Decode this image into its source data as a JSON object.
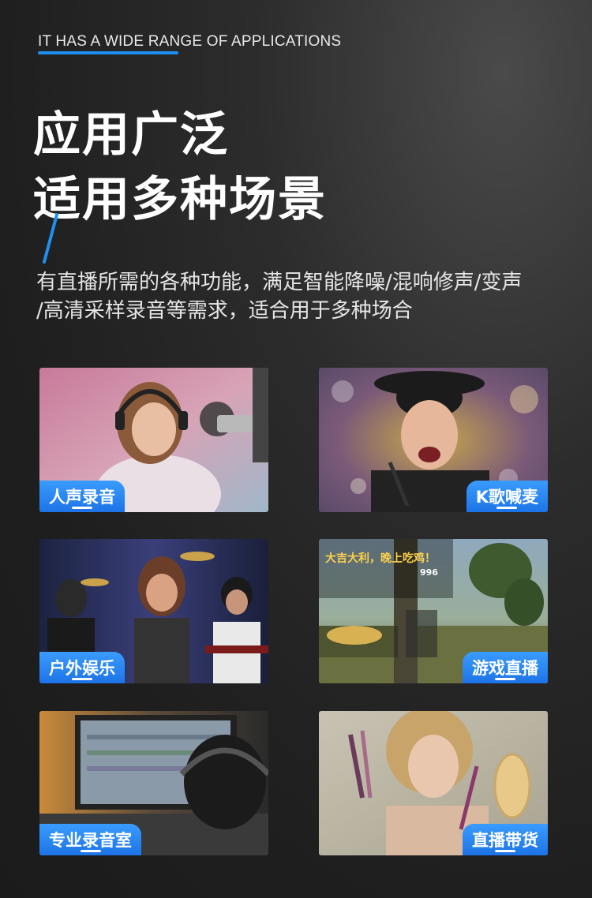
{
  "header": {
    "eyebrow": "IT HAS A WIDE RANGE OF APPLICATIONS",
    "title_line1": "应用广泛",
    "title_line2": "适用多种场景",
    "description_line1": "有直播所需的各种功能，满足智能降噪/混响修声/变声",
    "description_line2": "/高清采样录音等需求，适合用于多种场合",
    "accent_color": "#1e8ff0"
  },
  "cards": [
    {
      "label": "人声录音",
      "icon": "vocal-recording-photo"
    },
    {
      "label": "K歌喊麦",
      "icon": "karaoke-photo"
    },
    {
      "label": "户外娱乐",
      "icon": "outdoor-entertainment-photo"
    },
    {
      "label": "游戏直播",
      "icon": "game-streaming-photo"
    },
    {
      "label": "专业录音室",
      "icon": "recording-studio-photo"
    },
    {
      "label": "直播带货",
      "icon": "live-commerce-photo"
    }
  ],
  "game_overlay": {
    "banner": "大吉大利，晚上吃鸡！",
    "score": "996"
  },
  "tag_color": "#2a86f2"
}
